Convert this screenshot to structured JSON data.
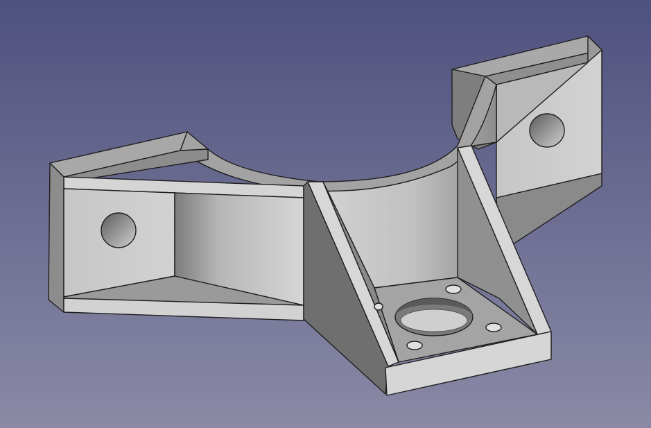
{
  "app": {
    "view": "3d-viewport",
    "background": {
      "top": "#4f517e",
      "bottom": "#8a8aa6"
    }
  },
  "model": {
    "part": "pipe-clamp-bracket",
    "colors": {
      "face_light": "#cdcdcd",
      "face_mid": "#b2b2b2",
      "face_dark": "#8e8e8e",
      "face_shadow": "#6f6f6f",
      "edge": "#1e1e1e",
      "hole": "#6a6a6a"
    }
  }
}
